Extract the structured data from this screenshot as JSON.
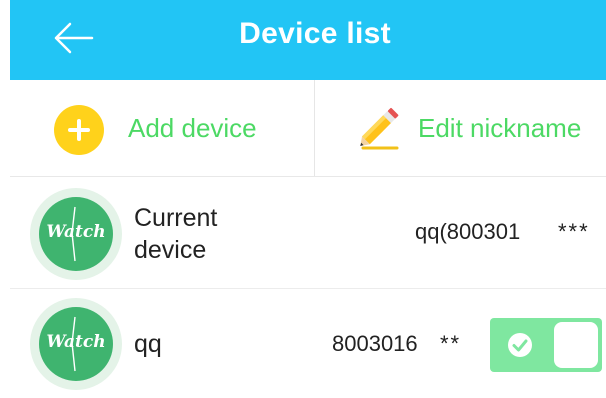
{
  "header": {
    "title": "Device list",
    "back_icon": "arrow-left-icon",
    "background": "#22c5f5"
  },
  "actions": {
    "add_label": "Add device",
    "add_icon": "plus-circle-icon",
    "edit_label": "Edit nickname",
    "edit_icon": "pencil-icon",
    "accent": "#4cd964"
  },
  "devices": [
    {
      "name": "Current device",
      "avatar_text": "Watch",
      "id": "qq(800301",
      "masked": "***"
    },
    {
      "name": "qq",
      "avatar_text": "Watch",
      "id": "8003016",
      "masked": "**",
      "toggle_on": true
    }
  ]
}
